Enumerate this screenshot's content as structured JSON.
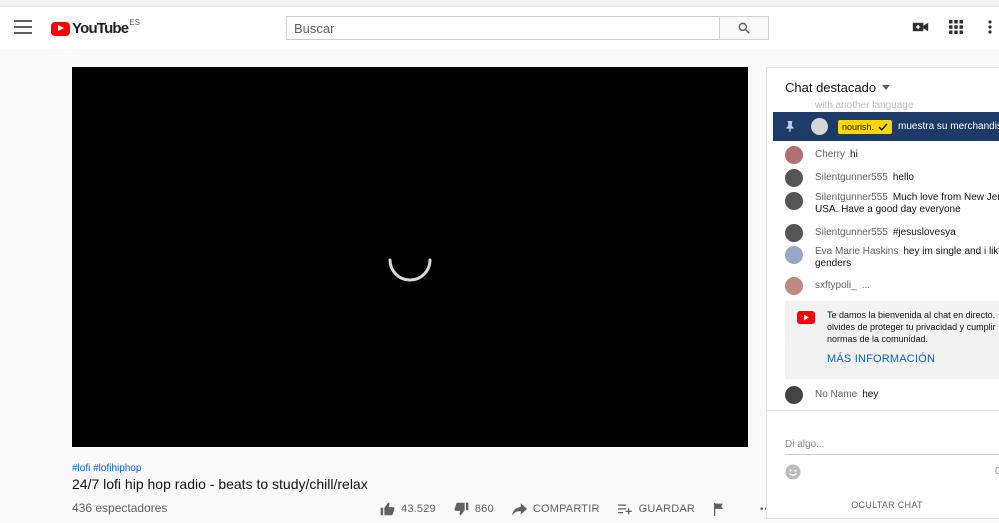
{
  "masthead": {
    "logo_text": "YouTube",
    "region": "ES",
    "search_placeholder": "Buscar"
  },
  "video": {
    "tags": "#lofi #lofihiphop",
    "title": "24/7 lofi hip hop radio - beats to study/chill/relax",
    "viewers": "436 espectadores",
    "likes": "43.529",
    "dislikes": "860",
    "share_label": "COMPARTIR",
    "save_label": "GUARDAR",
    "more_label": "•••"
  },
  "chat": {
    "header": "Chat destacado",
    "faded_text": "with another language",
    "pinned": {
      "author": "nourish.",
      "text": "muestra su merchandis"
    },
    "messages": [
      {
        "author": "Cherry",
        "text": "hi",
        "color": "#b07070"
      },
      {
        "author": "Silentgunner555",
        "text": "hello",
        "color": "#555555"
      },
      {
        "author": "Silentgunner555",
        "text": "Much love from New Jers",
        "text2": "USA. Have a good day everyone",
        "color": "#555555"
      },
      {
        "author": "Silentgunner555",
        "text": "#jesuslovesya",
        "color": "#555555"
      },
      {
        "author": "Eva Marie Haskins",
        "text": "hey im single and i like",
        "text2": "genders",
        "color": "#9aa6c8"
      },
      {
        "author": "sxftypoli_",
        "text": "...",
        "color": "#c08a80"
      }
    ],
    "notice_text": "Te damos la bienvenida al chat en directo. olvides de proteger tu privacidad y cumplir normas de la comunidad.",
    "notice_link": "MÁS INFORMACIÓN",
    "last_message": {
      "author": "No Name",
      "text": "hey"
    },
    "input_placeholder": "Di algo...",
    "char_counter": "0",
    "hide_chat": "OCULTAR CHAT"
  },
  "colors": {
    "brand_red": "#ff0000",
    "link_blue": "#065fd4",
    "pinned_bg": "#1e3a66",
    "badge_yellow": "#ffd600"
  }
}
